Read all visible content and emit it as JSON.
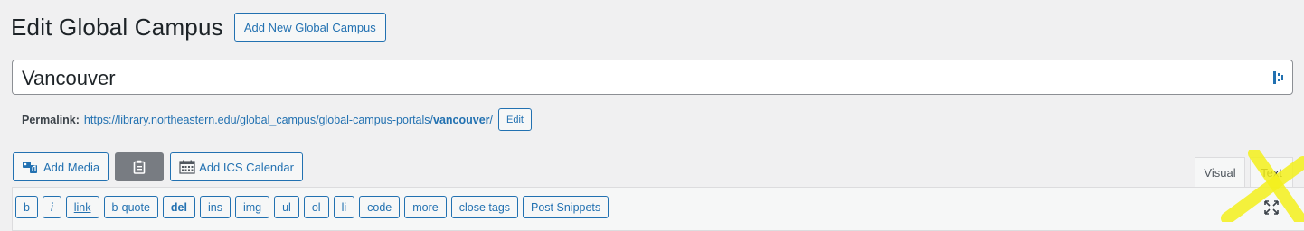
{
  "header": {
    "title": "Edit Global Campus",
    "add_new_label": "Add New Global Campus"
  },
  "post_title": {
    "value": "Vancouver"
  },
  "permalink": {
    "label": "Permalink:",
    "url_base": "https://library.northeastern.edu/global_campus/global-campus-portals/",
    "slug": "vancouver",
    "trailing": "/",
    "edit_label": "Edit"
  },
  "media_buttons": {
    "add_media_label": "Add Media",
    "add_ics_label": "Add ICS Calendar"
  },
  "editor_tabs": {
    "visual_label": "Visual",
    "text_label": "Text"
  },
  "quicktags": {
    "buttons": [
      "b",
      "i",
      "link",
      "b-quote",
      "del",
      "ins",
      "img",
      "ul",
      "ol",
      "li",
      "code",
      "more",
      "close tags",
      "Post Snippets"
    ]
  },
  "icons": {
    "add_media": "add-media-icon",
    "clipboard": "clipboard-icon",
    "calendar": "calendar-icon",
    "fullscreen": "fullscreen-icon",
    "title_field": "title-field-icon"
  },
  "colors": {
    "accent": "#2271b1",
    "background": "#f0f0f1",
    "dark_button": "#787c82",
    "highlight": "#f4f01c"
  }
}
